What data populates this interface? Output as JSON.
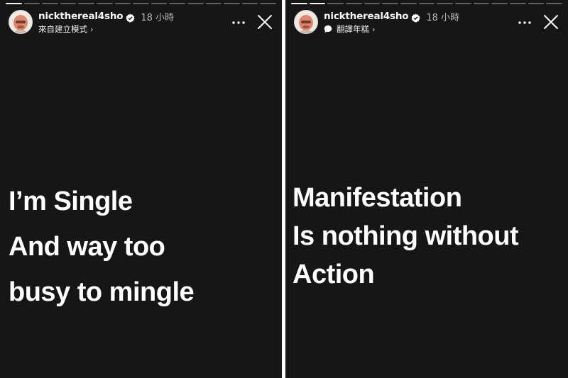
{
  "panels": [
    {
      "username": "nickthereal4sho",
      "timestamp": "18 小時",
      "subtitle": "來自建立模式",
      "subtitle_chevron": "›",
      "text_lines": [
        "I’m Single",
        "And way too",
        "busy to mingle"
      ]
    },
    {
      "username": "nickthereal4sho",
      "timestamp": "18 小時",
      "subtitle": "翻譯年糕",
      "subtitle_chevron": "›",
      "text_lines": [
        "Manifestation",
        "Is nothing without",
        "Action"
      ]
    }
  ],
  "icons": {
    "verified": "verified-badge-icon",
    "more": "more-options-icon",
    "close": "close-icon",
    "subtitle_right": "chat-bubble-icon"
  },
  "colors": {
    "background": "#161616",
    "text": "#ffffff",
    "muted": "#b9b9b9"
  }
}
